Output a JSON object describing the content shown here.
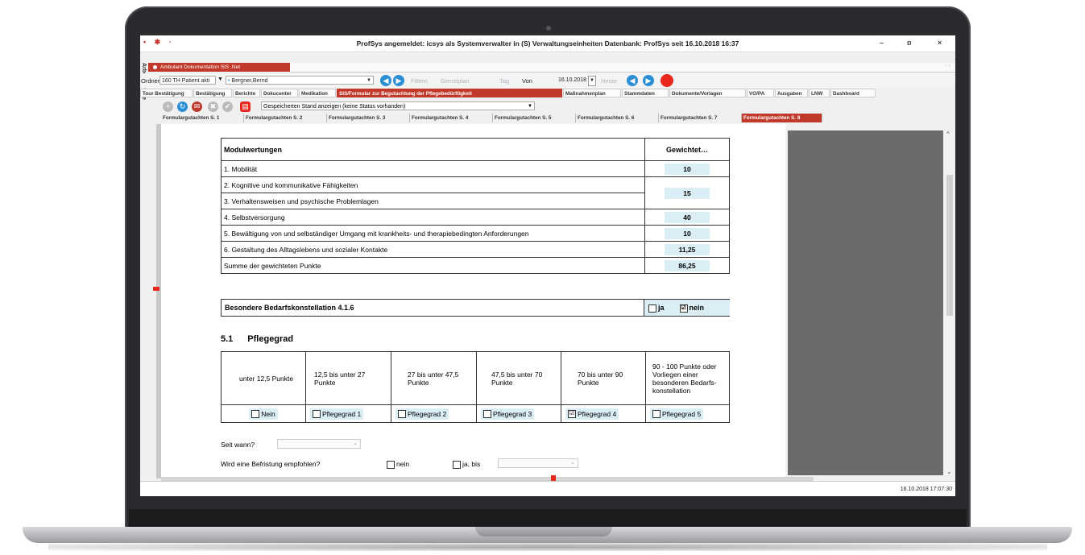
{
  "window": {
    "title": "ProfSys angemeldet: icsys als Systemverwalter in (S) Verwaltungseinheiten Datenbank: ProfSys seit 16.10.2018 16:37",
    "left_controls": "• ✱ ·",
    "minimize": "–",
    "restore": "ɒ",
    "close": "×"
  },
  "sidebar_label": "Arbeitszimmer",
  "doc_tab": {
    "label": "Ambulant Dokumentation SIS .Net",
    "dots": "· ·"
  },
  "ordner_row": {
    "ordner_label": "Ordner",
    "ordner_value": "160 TH Patient akti",
    "patient_value": "Bergner,Bernd",
    "filter_label": "Filtern",
    "dienstplan_label": "Dienstplan",
    "tag_label": "Tag",
    "von_label": "Von",
    "date_value": "16.10.2018",
    "heute_label": "Heute"
  },
  "tabs": [
    "Tour Bestätigung",
    "Bestätigung",
    "Berichte",
    "Dokucenter",
    "Medikation",
    "SIS/Formular zur Begutachtung der Pflegebedürftigkeit",
    "Maßnahmenplan",
    "Stammdaten",
    "Dokumente/Vorlagen",
    "VO/PA",
    "Ausgaben",
    "LNW",
    "Dashboard"
  ],
  "toolbar": {
    "dropdown_value": "Gespeicherten Stand anzeigen (keine Status vorhanden)"
  },
  "subtabs": [
    "Formulargutachten S. 1",
    "Formulargutachten S. 2",
    "Formulargutachten S. 3",
    "Formulargutachten S. 4",
    "Formulargutachten S. 5",
    "Formulargutachten S. 6",
    "Formulargutachten S. 7",
    "Formulargutachten S. 8"
  ],
  "modul": {
    "header_left": "Modulwertungen",
    "header_right": "Gewichtet…",
    "rows": [
      {
        "label": "1. Mobilität",
        "value": "10"
      },
      {
        "label": "2. Kognitive und kommunikative Fähigkeiten",
        "value": "15"
      },
      {
        "label": "3. Verhaltensweisen und psychische Problemlagen",
        "value": ""
      },
      {
        "label": "4. Selbstversorgung",
        "value": "40"
      },
      {
        "label": "5. Bewältigung von und selbständiger Umgang mit krankheits- und therapiebedingten Anforderungen",
        "value": "10"
      },
      {
        "label": "6. Gestaltung des Alltagslebens und sozialer Kontakte",
        "value": "11,25"
      },
      {
        "label": "Summe der gewichteten Punkte",
        "value": "86,25"
      }
    ]
  },
  "besondere": {
    "label": "Besondere Bedarfskonstellation 4.1.6",
    "ja": "ja",
    "nein": "nein",
    "nein_mark": "☑"
  },
  "pflegegrad": {
    "number": "5.1",
    "title": "Pflegegrad",
    "ranges": [
      "unter 12,5 Punkte",
      "12,5 bis unter 27 Punkte",
      "27 bis unter 47,5 Punkte",
      "47,5 bis unter 70 Punkte",
      "70 bis unter 90 Punkte",
      "90 - 100 Punkte oder Vorliegen einer besonderen Bedarfs-konstellation"
    ],
    "options": [
      "Nein",
      "Pflegegrad 1",
      "Pflegegrad 2",
      "Pflegegrad 3",
      "Pflegegrad 4",
      "Pflegegrad 5"
    ],
    "check_mark": "☑"
  },
  "seit_wann": {
    "label": "Seit wann?"
  },
  "befristung": {
    "label": "Wird eine Befristung empfohlen?",
    "nein": "nein",
    "ja_bis": "ja, bis"
  },
  "status": {
    "timestamp": "16.10.2018 17:07:30"
  },
  "colors": {
    "accent_red": "#c0392b",
    "nav_blue": "#2b8fd6",
    "value_bg": "#dbeef6"
  }
}
